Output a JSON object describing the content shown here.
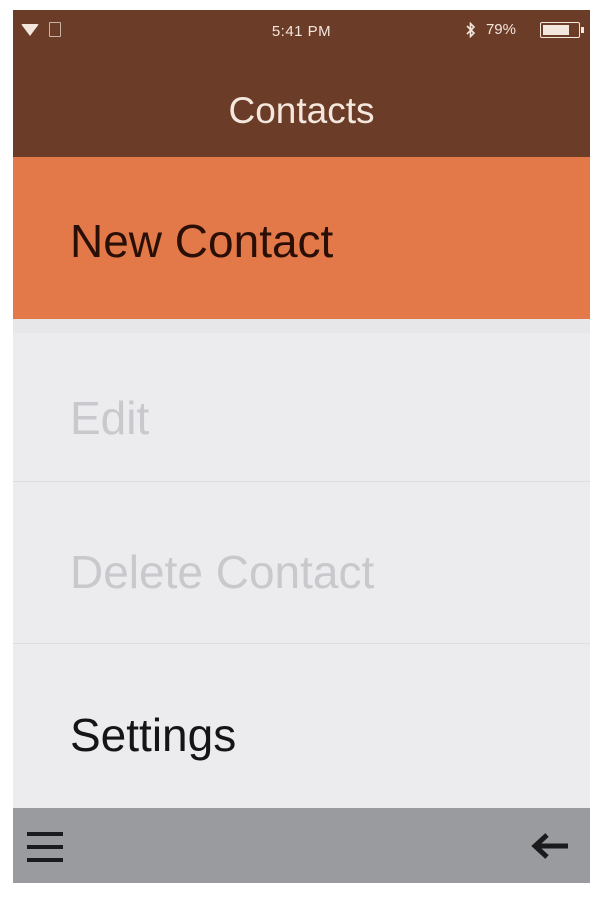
{
  "status_bar": {
    "time": "5:41 PM",
    "battery_percent": "79%",
    "battery_level": 0.79,
    "icons": [
      "wifi-icon",
      "sim-icon",
      "bluetooth-icon",
      "battery-icon"
    ]
  },
  "header": {
    "title": "Contacts"
  },
  "menu": {
    "items": [
      {
        "label": "New Contact",
        "state": "highlighted"
      },
      {
        "label": "Edit",
        "state": "disabled"
      },
      {
        "label": "Delete Contact",
        "state": "disabled"
      },
      {
        "label": "Settings",
        "state": "enabled"
      }
    ]
  },
  "bottom_bar": {
    "icons": [
      "hamburger-menu-icon",
      "back-arrow-icon"
    ]
  },
  "colors": {
    "header_bg": "#6b3c28",
    "highlight_bg": "#e37849",
    "list_bg": "#ececef",
    "bottom_bar_bg": "#9a9b9e",
    "disabled_text": "#c9c9cd"
  }
}
